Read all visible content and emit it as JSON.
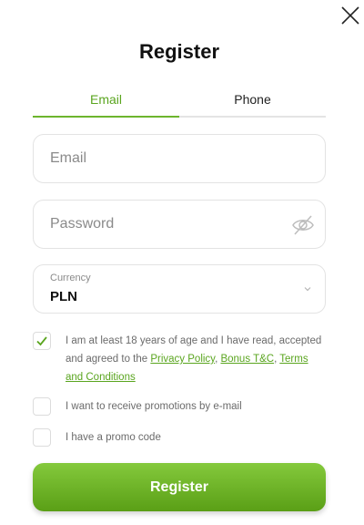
{
  "dialog": {
    "title": "Register",
    "close_icon": "close-icon"
  },
  "tabs": [
    {
      "label": "Email",
      "active": true
    },
    {
      "label": "Phone",
      "active": false
    }
  ],
  "form": {
    "email": {
      "placeholder": "Email",
      "value": ""
    },
    "password": {
      "placeholder": "Password",
      "value": "",
      "toggle_icon": "eye-slash-icon"
    },
    "currency": {
      "label": "Currency",
      "value": "PLN",
      "icon": "chevron-down-icon"
    }
  },
  "checkboxes": {
    "terms": {
      "checked": true,
      "text_before": "I am at least 18 years of age and I have read, accepted and agreed to the ",
      "link_privacy": "Privacy Policy",
      "sep1": ", ",
      "link_bonus": "Bonus T&C",
      "sep2": ", ",
      "link_terms": "Terms and Conditions"
    },
    "promo_email": {
      "checked": false,
      "label": "I want to receive promotions by e-mail"
    },
    "promo_code": {
      "checked": false,
      "label": "I have a promo code"
    }
  },
  "submit": {
    "label": "Register"
  },
  "colors": {
    "accent": "#6cb52d",
    "accent_text": "#5aa51f",
    "button_top": "#84c93c",
    "button_bottom": "#5a9f16"
  }
}
